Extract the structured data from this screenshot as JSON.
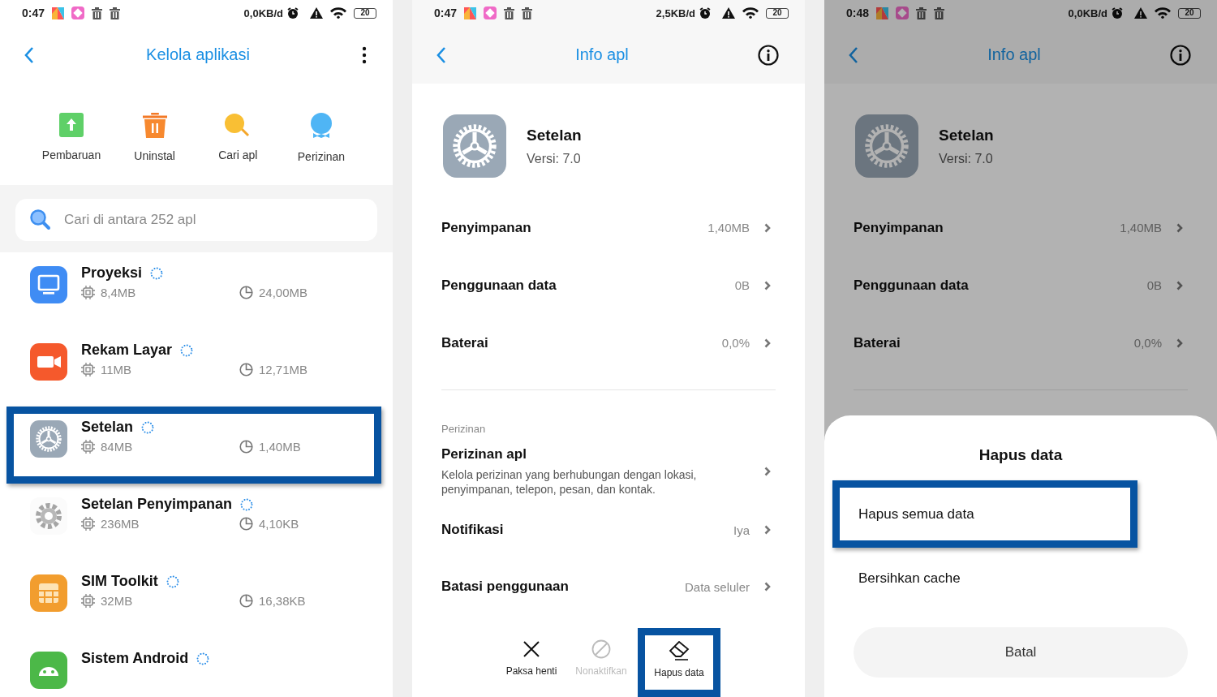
{
  "screens": [
    {
      "kind": "app_list",
      "dimmed": false,
      "status_bar": {
        "time": "0:47",
        "speed": "0,0KB/d",
        "battery": "20"
      },
      "title": "Kelola aplikasi",
      "shortcuts": [
        {
          "label": "Pembaruan",
          "kind": "update"
        },
        {
          "label": "Uninstal",
          "kind": "uninstall"
        },
        {
          "label": "Cari apl",
          "kind": "find"
        },
        {
          "label": "Perizinan",
          "kind": "permission"
        }
      ],
      "search": {
        "placeholder": "Cari di antara 252 apl"
      },
      "apps": [
        {
          "name": "Proyeksi",
          "kind": "projection",
          "memory": "8,4MB",
          "storage": "24,00MB",
          "highlighted": false
        },
        {
          "name": "Rekam Layar",
          "kind": "recorder",
          "memory": "11MB",
          "storage": "12,71MB",
          "highlighted": false
        },
        {
          "name": "Setelan",
          "kind": "settings",
          "memory": "84MB",
          "storage": "1,40MB",
          "highlighted": true
        },
        {
          "name": "Setelan Penyimpanan",
          "kind": "storage",
          "memory": "236MB",
          "storage": "4,10KB",
          "highlighted": false
        },
        {
          "name": "SIM Toolkit",
          "kind": "sim",
          "memory": "32MB",
          "storage": "16,38KB",
          "highlighted": false
        },
        {
          "name": "Sistem Android",
          "kind": "android",
          "highlighted": false
        }
      ]
    },
    {
      "kind": "app_info",
      "dimmed": false,
      "status_bar": {
        "time": "0:47",
        "speed": "2,5KB/d",
        "battery": "20"
      },
      "title": "Info apl",
      "app": {
        "name": "Setelan",
        "version": "Versi: 7.0"
      },
      "rows": [
        {
          "label": "Penyimpanan",
          "value": "1,40MB"
        },
        {
          "label": "Penggunaan data",
          "value": "0B"
        },
        {
          "label": "Baterai",
          "value": "0,0%"
        }
      ],
      "section": {
        "title": "Perizinan",
        "rows": [
          {
            "label": "Perizinan apl",
            "description": "Kelola perizinan yang berhubungan dengan lokasi, penyimpanan, telepon, pesan, dan kontak."
          },
          {
            "label": "Notifikasi",
            "value": "Iya"
          },
          {
            "label": "Batasi penggunaan",
            "value": "Data seluler"
          }
        ]
      },
      "actions": [
        {
          "label": "Paksa henti",
          "kind": "stop",
          "disabled": false,
          "highlighted": false
        },
        {
          "label": "Nonaktifkan",
          "kind": "disable",
          "disabled": true,
          "highlighted": false
        },
        {
          "label": "Hapus data",
          "kind": "erase",
          "disabled": false,
          "highlighted": true
        }
      ]
    },
    {
      "kind": "app_info",
      "dimmed": true,
      "status_bar": {
        "time": "0:48",
        "speed": "0,0KB/d",
        "battery": "20"
      },
      "title": "Info apl",
      "app": {
        "name": "Setelan",
        "version": "Versi: 7.0"
      },
      "rows": [
        {
          "label": "Penyimpanan",
          "value": "1,40MB"
        },
        {
          "label": "Penggunaan data",
          "value": "0B"
        },
        {
          "label": "Baterai",
          "value": "0,0%"
        }
      ],
      "sheet": {
        "title": "Hapus data",
        "options": [
          {
            "label": "Hapus semua data",
            "highlighted": true
          },
          {
            "label": "Bersihkan cache",
            "highlighted": false
          }
        ],
        "cancel": "Batal"
      }
    }
  ]
}
